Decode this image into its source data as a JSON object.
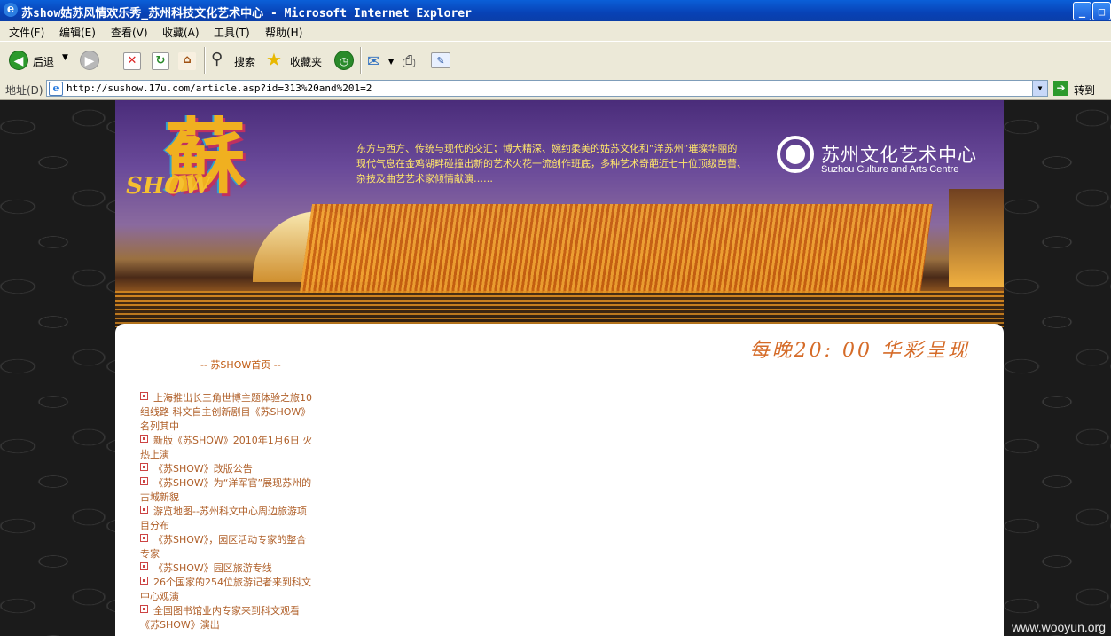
{
  "window": {
    "title": "苏show姑苏风情欢乐秀_苏州科技文化艺术中心 - Microsoft Internet Explorer",
    "controls": {
      "minimize": "_",
      "maximize": "□"
    }
  },
  "menu": [
    "文件(F)",
    "编辑(E)",
    "查看(V)",
    "收藏(A)",
    "工具(T)",
    "帮助(H)"
  ],
  "toolbar": {
    "back_label": "后退",
    "search_label": "搜索",
    "favorites_label": "收藏夹"
  },
  "address": {
    "label": "地址(D)",
    "url": "http://sushow.17u.com/article.asp?id=313%20and%201=2",
    "go_label": "转到"
  },
  "banner": {
    "logo_text": "蘇",
    "logo_show": "SHOW",
    "intro": "东方与西方、传统与现代的交汇；博大精深、婉约柔美的姑苏文化和“洋苏州”璀璨华丽的现代气息在金鸡湖畔碰撞出新的艺术火花一流创作班底，多种艺术奇葩近七十位顶级芭蕾、杂技及曲艺艺术家倾情献演……",
    "org_zh": "苏州文化艺术中心",
    "org_en": "Suzhou Culture and Arts Centre"
  },
  "content": {
    "slogan": "每晚20: 00 华彩呈现",
    "home_link": "-- 苏SHOW首页 --",
    "news": [
      "上海推出长三角世博主题体验之旅10组线路 科文自主创新剧目《苏SHOW》名列其中",
      "新版《苏SHOW》2010年1月6日 火热上演",
      "《苏SHOW》改版公告",
      "《苏SHOW》为“洋军官”展现苏州的古城新貌",
      "游览地图--苏州科文中心周边旅游项目分布",
      "《苏SHOW》，园区活动专家的整合专家",
      "《苏SHOW》园区旅游专线",
      "26个国家的254位旅游记者来到科文中心观演",
      "全国图书馆业内专家来到科文观看《苏SHOW》演出"
    ]
  },
  "watermark": "www.wooyun.org"
}
